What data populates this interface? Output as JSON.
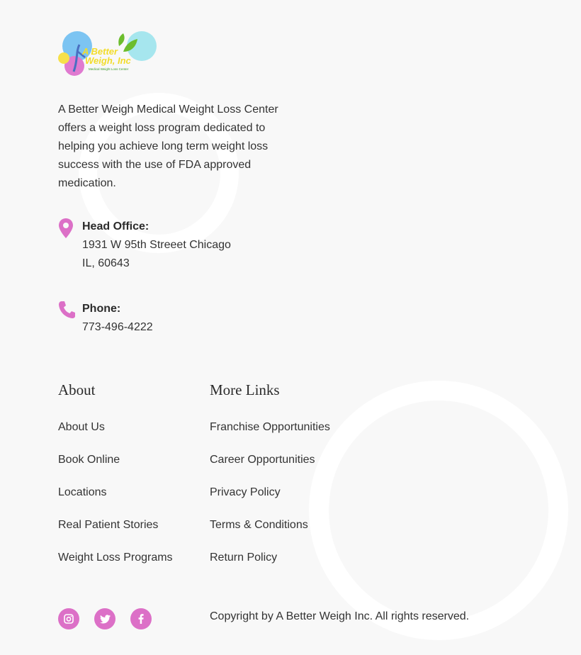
{
  "logo": {
    "line1": "A Better",
    "line2": "Weigh, Inc",
    "tagline": "Medical Weight Loss Center"
  },
  "intro": "A Better Weigh Medical Weight Loss Center offers a weight loss program dedicated to helping you achieve long term weight loss success with the use of FDA approved medication.",
  "office": {
    "icon": "map-pin-icon",
    "title": "Head Office:",
    "line1": "1931 W 95th Streeet Chicago",
    "line2": "IL, 60643"
  },
  "phone": {
    "icon": "phone-icon",
    "title": "Phone:",
    "number": "773-496-4222"
  },
  "about": {
    "heading": "About",
    "links": [
      "About Us",
      "Book Online",
      "Locations",
      "Real Patient Stories",
      "Weight Loss Programs"
    ]
  },
  "more_links": {
    "heading": "More Links",
    "links": [
      "Franchise Opportunities",
      "Career Opportunities",
      "Privacy Policy",
      "Terms & Conditions",
      "Return Policy"
    ]
  },
  "social": [
    "instagram-icon",
    "twitter-icon",
    "facebook-icon"
  ],
  "copyright": "Copyright by A Better Weigh Inc. All rights reserved.",
  "colors": {
    "accent": "#dc70c7",
    "background": "#f8f8f8",
    "text": "#2b2b2b"
  }
}
